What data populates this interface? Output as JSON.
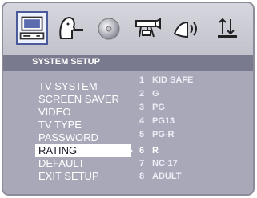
{
  "header": {
    "title": "SYSTEM SETUP",
    "icons": [
      {
        "name": "system-setup-icon",
        "selected": true
      },
      {
        "name": "language-setup-icon",
        "selected": false
      },
      {
        "name": "disc-icon",
        "selected": false
      },
      {
        "name": "video-setup-icon",
        "selected": false
      },
      {
        "name": "audio-setup-icon",
        "selected": false
      },
      {
        "name": "digital-setup-icon",
        "selected": false
      }
    ]
  },
  "menu": {
    "items": [
      {
        "label": "TV SYSTEM",
        "active": false
      },
      {
        "label": "SCREEN SAVER",
        "active": false
      },
      {
        "label": "VIDEO",
        "active": false
      },
      {
        "label": "TV TYPE",
        "active": false
      },
      {
        "label": "PASSWORD",
        "active": false
      },
      {
        "label": "RATING",
        "active": true
      },
      {
        "label": "DEFAULT",
        "active": false
      },
      {
        "label": "EXIT SETUP",
        "active": false
      }
    ]
  },
  "rating_options": [
    {
      "num": "1",
      "label": "KID SAFE"
    },
    {
      "num": "2",
      "label": "G"
    },
    {
      "num": "3",
      "label": "PG"
    },
    {
      "num": "4",
      "label": "PG13"
    },
    {
      "num": "5",
      "label": "PG-R"
    },
    {
      "num": "6",
      "label": "R",
      "active": true
    },
    {
      "num": "7",
      "label": "NC-17"
    },
    {
      "num": "8",
      "label": "ADULT"
    }
  ],
  "colors": {
    "frame": "#8c8c9c",
    "title_bar": "#7a7a8e",
    "panel": "#a8a8b8",
    "highlight": "#ffffff",
    "selected_icon": "#4a5a9a"
  }
}
